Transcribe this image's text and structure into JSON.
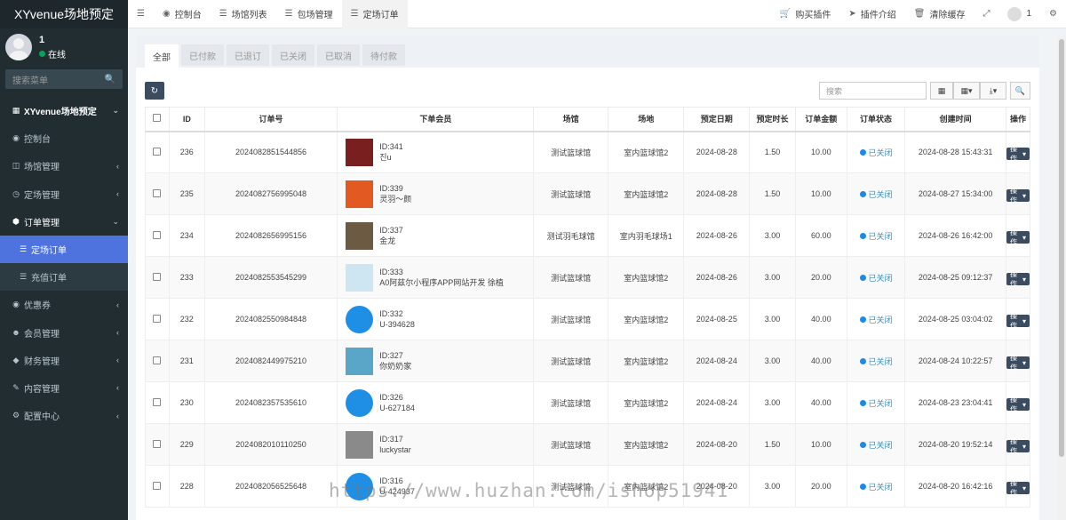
{
  "app": {
    "brand": "XYvenue场地预定",
    "user_name": "1",
    "user_status": "在线",
    "search_placeholder": "搜索菜单"
  },
  "sidebar": {
    "items": [
      {
        "label": "XYvenue场地预定",
        "icon": "grid-icon"
      },
      {
        "label": "控制台",
        "icon": "dashboard-icon"
      },
      {
        "label": "场馆管理",
        "icon": "book-icon"
      },
      {
        "label": "定场管理",
        "icon": "clock-icon"
      },
      {
        "label": "订单管理",
        "icon": "cube-icon"
      },
      {
        "label": "定场订单",
        "icon": "list-icon"
      },
      {
        "label": "充值订单",
        "icon": "list-icon"
      },
      {
        "label": "优惠券",
        "icon": "ticket-icon"
      },
      {
        "label": "会员管理",
        "icon": "users-icon"
      },
      {
        "label": "财务管理",
        "icon": "diamond-icon"
      },
      {
        "label": "内容管理",
        "icon": "edit-icon"
      },
      {
        "label": "配置中心",
        "icon": "cog-icon"
      }
    ]
  },
  "topbar": {
    "tabs": [
      "控制台",
      "场馆列表",
      "包场管理",
      "定场订单"
    ],
    "right": [
      "购买插件",
      "插件介绍",
      "清除缓存"
    ],
    "user": "1"
  },
  "tabs": [
    "全部",
    "已付款",
    "已退订",
    "已关闭",
    "已取消",
    "待付款"
  ],
  "toolbar": {
    "search_placeholder": "搜索"
  },
  "table": {
    "headers": [
      "ID",
      "订单号",
      "下单会员",
      "场馆",
      "场地",
      "预定日期",
      "预定时长",
      "订单金额",
      "订单状态",
      "创建时间",
      "操作"
    ],
    "op_label": "操作",
    "rows": [
      {
        "id": "236",
        "order": "2024082851544856",
        "member_id": "ID:341",
        "member_name": "진u",
        "venue": "测试篮球馆",
        "court": "室内篮球馆2",
        "date": "2024-08-28",
        "hours": "1.50",
        "amount": "10.00",
        "status": "已关闭",
        "created": "2024-08-28 15:43:31"
      },
      {
        "id": "235",
        "order": "2024082756995048",
        "member_id": "ID:339",
        "member_name": "灵羽～颜",
        "venue": "测试篮球馆",
        "court": "室内篮球馆2",
        "date": "2024-08-28",
        "hours": "1.50",
        "amount": "10.00",
        "status": "已关闭",
        "created": "2024-08-27 15:34:00"
      },
      {
        "id": "234",
        "order": "2024082656995156",
        "member_id": "ID:337",
        "member_name": "金龙",
        "venue": "测试羽毛球馆",
        "court": "室内羽毛球场1",
        "date": "2024-08-26",
        "hours": "3.00",
        "amount": "60.00",
        "status": "已关闭",
        "created": "2024-08-26 16:42:00"
      },
      {
        "id": "233",
        "order": "2024082553545299",
        "member_id": "ID:333",
        "member_name": "A0阿兹尔小程序APP网站开发 徐植",
        "venue": "测试篮球馆",
        "court": "室内篮球馆2",
        "date": "2024-08-26",
        "hours": "3.00",
        "amount": "20.00",
        "status": "已关闭",
        "created": "2024-08-25 09:12:37"
      },
      {
        "id": "232",
        "order": "2024082550984848",
        "member_id": "ID:332",
        "member_name": "U-394628",
        "venue": "测试篮球馆",
        "court": "室内篮球馆2",
        "date": "2024-08-25",
        "hours": "3.00",
        "amount": "40.00",
        "status": "已关闭",
        "created": "2024-08-25 03:04:02"
      },
      {
        "id": "231",
        "order": "2024082449975210",
        "member_id": "ID:327",
        "member_name": "你奶奶家",
        "venue": "测试篮球馆",
        "court": "室内篮球馆2",
        "date": "2024-08-24",
        "hours": "3.00",
        "amount": "40.00",
        "status": "已关闭",
        "created": "2024-08-24 10:22:57"
      },
      {
        "id": "230",
        "order": "2024082357535610",
        "member_id": "ID:326",
        "member_name": "U-627184",
        "venue": "测试篮球馆",
        "court": "室内篮球馆2",
        "date": "2024-08-24",
        "hours": "3.00",
        "amount": "40.00",
        "status": "已关闭",
        "created": "2024-08-23 23:04:41"
      },
      {
        "id": "229",
        "order": "2024082010110250",
        "member_id": "ID:317",
        "member_name": "luckystar",
        "venue": "测试篮球馆",
        "court": "室内篮球馆2",
        "date": "2024-08-20",
        "hours": "1.50",
        "amount": "10.00",
        "status": "已关闭",
        "created": "2024-08-20 19:52:14"
      },
      {
        "id": "228",
        "order": "2024082056525648",
        "member_id": "ID:316",
        "member_name": "U-424937",
        "venue": "测试篮球馆",
        "court": "室内篮球馆2",
        "date": "2024-08-20",
        "hours": "3.00",
        "amount": "20.00",
        "status": "已关闭",
        "created": "2024-08-20 16:42:16"
      }
    ]
  },
  "watermark": "https://www.huzhan.com/ishop51941"
}
